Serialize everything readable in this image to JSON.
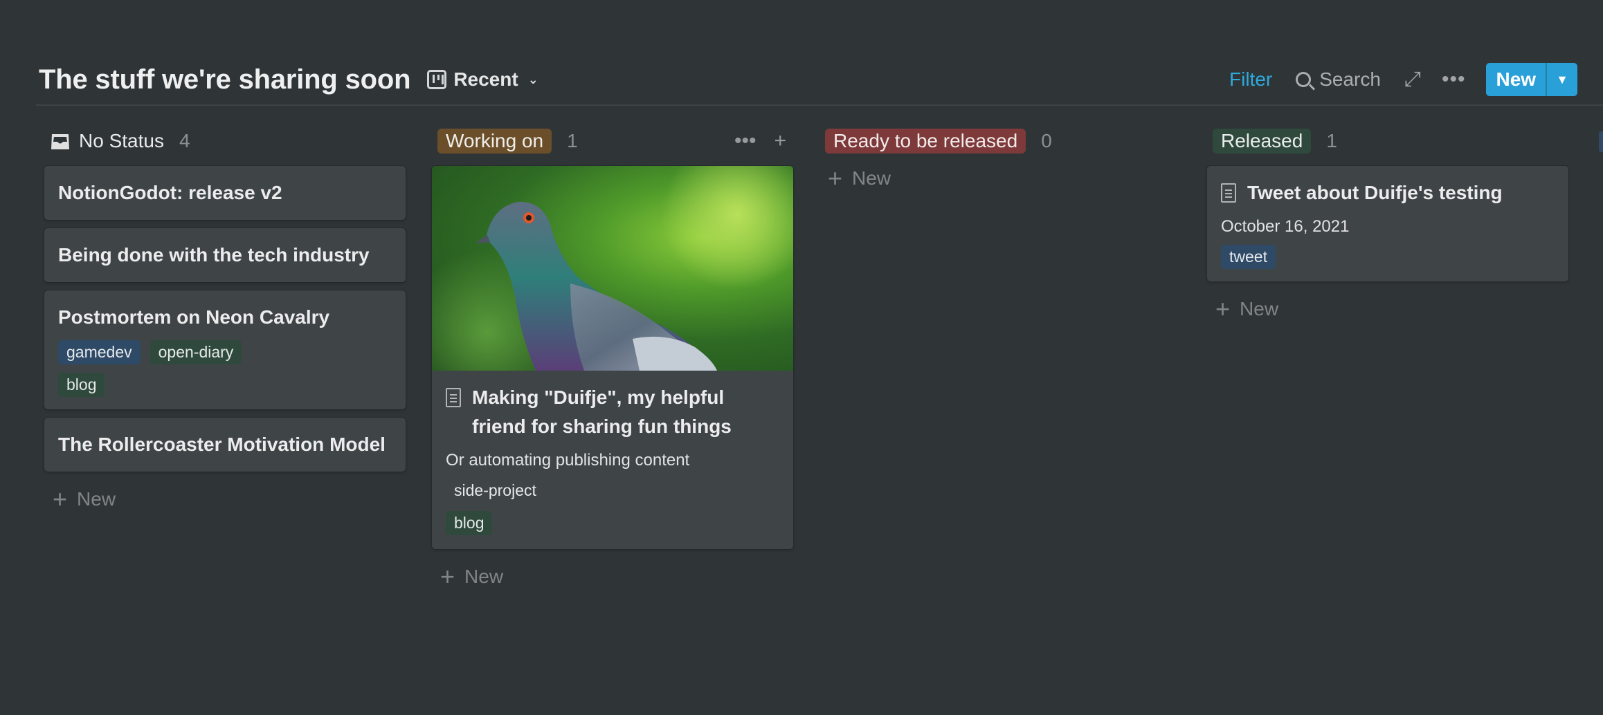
{
  "header": {
    "title": "The stuff we're sharing soon",
    "view_label": "Recent",
    "filter_label": "Filter",
    "search_label": "Search",
    "new_label": "New"
  },
  "columns": [
    {
      "name": "No Status",
      "count": "4",
      "cards": [
        {
          "title": "NotionGodot: release v2"
        },
        {
          "title": "Being done with the tech industry"
        },
        {
          "title": "Postmortem on Neon Cavalry",
          "tags": [
            "gamedev",
            "open-diary",
            "blog"
          ]
        },
        {
          "title": "The Rollercoaster Motivation Model"
        }
      ],
      "add_label": "New"
    },
    {
      "name": "Working on",
      "count": "1",
      "color": "#6b4f2a",
      "cards": [
        {
          "title": "Making \"Duifje\", my helpful friend for sharing fun things",
          "subtitle": "Or automating publishing content",
          "tags": [
            "side-project",
            "blog"
          ]
        }
      ],
      "add_label": "New"
    },
    {
      "name": "Ready to be released",
      "count": "0",
      "color": "#7e3a3a",
      "add_label": "New"
    },
    {
      "name": "Released",
      "count": "1",
      "color": "#2f4a3c",
      "cards": [
        {
          "title": "Tweet about Duifje's testing",
          "date": "October 16, 2021",
          "tags": [
            "tweet"
          ]
        }
      ],
      "add_label": "New"
    }
  ],
  "icons": [
    "inbox-icon",
    "board-icon",
    "search-icon",
    "expand-icon",
    "more-icon",
    "page-icon",
    "plus-icon"
  ],
  "colors": {
    "background": "#2f3437",
    "card": "#3f4447",
    "accent": "#2aa0d8"
  }
}
